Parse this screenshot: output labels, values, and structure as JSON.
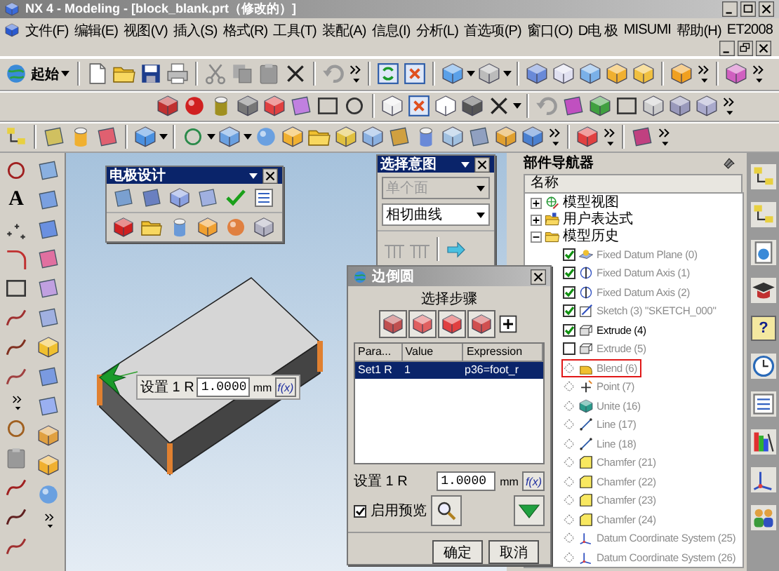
{
  "window": {
    "title": "NX 4 - Modeling - [block_blank.prt（修改的）]"
  },
  "menu": [
    "文件(F)",
    "编辑(E)",
    "视图(V)",
    "插入(S)",
    "格式(R)",
    "工具(T)",
    "装配(A)",
    "信息(I)",
    "分析(L)",
    "首选项(P)",
    "窗口(O)",
    "D电 极",
    "MISUMI",
    "帮助(H)",
    "ET2008"
  ],
  "start_button": {
    "label": "起始"
  },
  "left_toolbar": {
    "text_tool": "A"
  },
  "electrode_panel": {
    "title": "电极设计"
  },
  "selection_intent": {
    "title": "选择意图",
    "face_rule": {
      "value": "单个面",
      "disabled": true
    },
    "curve_rule": {
      "value": "相切曲线",
      "disabled": false
    }
  },
  "viewport_tag": {
    "label": "设置 1 R",
    "value": "1.0000",
    "unit": "mm",
    "formula": "f(x)"
  },
  "part_navigator": {
    "title": "部件导航器",
    "column": "名称",
    "tree": [
      {
        "label": "模型视图",
        "expanded": false
      },
      {
        "label": "用户表达式",
        "expanded": false
      },
      {
        "label": "模型历史",
        "expanded": true,
        "children": [
          {
            "label": "Fixed Datum Plane (0)",
            "kind": "checkbox",
            "checked": true,
            "active": false,
            "selected": false
          },
          {
            "label": "Fixed Datum Axis (1)",
            "kind": "checkbox",
            "checked": true,
            "active": false,
            "selected": false
          },
          {
            "label": "Fixed Datum Axis (2)",
            "kind": "checkbox",
            "checked": true,
            "active": false,
            "selected": false
          },
          {
            "label": "Sketch (3) \"SKETCH_000\"",
            "kind": "checkbox",
            "checked": true,
            "active": false,
            "selected": false
          },
          {
            "label": "Extrude (4)",
            "kind": "checkbox",
            "checked": true,
            "active": true,
            "selected": false
          },
          {
            "label": "Extrude (5)",
            "kind": "checkbox",
            "checked": false,
            "active": false,
            "selected": false
          },
          {
            "label": "Blend (6)",
            "kind": "rollback",
            "active": false,
            "selected": true
          },
          {
            "label": "Point (7)",
            "kind": "rollback",
            "active": false,
            "selected": false
          },
          {
            "label": "Unite (16)",
            "kind": "rollback",
            "active": false,
            "selected": false
          },
          {
            "label": "Line (17)",
            "kind": "rollback",
            "active": false,
            "selected": false
          },
          {
            "label": "Line (18)",
            "kind": "rollback",
            "active": false,
            "selected": false
          },
          {
            "label": "Chamfer (21)",
            "kind": "rollback",
            "active": false,
            "selected": false
          },
          {
            "label": "Chamfer (22)",
            "kind": "rollback",
            "active": false,
            "selected": false
          },
          {
            "label": "Chamfer (23)",
            "kind": "rollback",
            "active": false,
            "selected": false
          },
          {
            "label": "Chamfer (24)",
            "kind": "rollback",
            "active": false,
            "selected": false
          },
          {
            "label": "Datum Coordinate System (25)",
            "kind": "rollback",
            "active": false,
            "selected": false
          },
          {
            "label": "Datum Coordinate System (26)",
            "kind": "rollback",
            "active": false,
            "selected": false
          }
        ]
      }
    ]
  },
  "resource_bar": {
    "help": "?"
  },
  "blend_dialog": {
    "title": "边倒圆",
    "steps_label": "选择步骤",
    "table": {
      "columns": [
        "Para...",
        "Value",
        "Expression"
      ],
      "rows": [
        {
          "cells": [
            "Set1 R",
            "1",
            "p36=foot_r"
          ],
          "selected": true
        }
      ]
    },
    "radius": {
      "label": "设置 1 R",
      "value": "1.0000",
      "unit": "mm",
      "formula": "f(x)"
    },
    "preview": {
      "label": "启用预览",
      "checked": true
    },
    "buttons": [
      "确定",
      "取消"
    ]
  }
}
